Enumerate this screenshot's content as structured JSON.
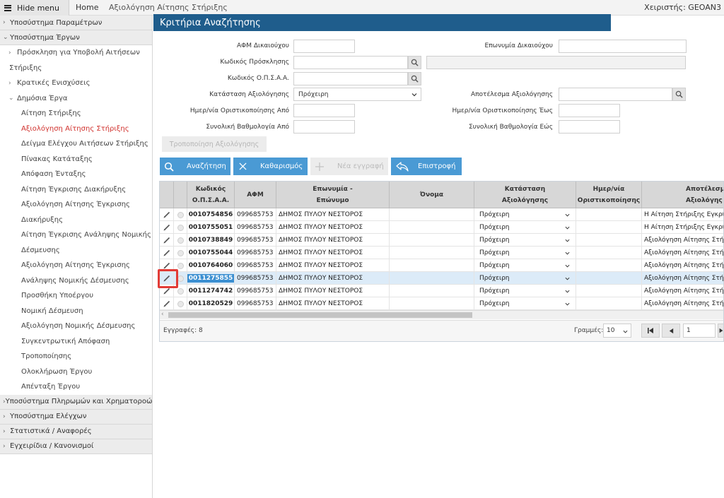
{
  "topbar": {
    "hide_menu": "Hide menu",
    "home": "Home",
    "breadcrumb": "Αξιολόγηση Αίτησης Στήριξης",
    "user": "Χειριστής: GEOAN3"
  },
  "sidebar": {
    "sec_params": "Υποσύστημα Παραμέτρων",
    "sec_projects": "Υποσύστημα Έργων",
    "sub_invitation_1": "Πρόσκληση για Υποβολή Αιτήσεων",
    "sub_invitation_2": "Στήριξης",
    "sub_state_aid": "Κρατικές Ενισχύσεις",
    "sub_public_works": "Δημόσια Έργα",
    "leaves": [
      "Αίτηση Στήριξης",
      "Αξιολόγηση Αίτησης Στήριξης",
      "Δείγμα Ελέγχου Αιτήσεων Στήριξης",
      "Πίνακας Κατάταξης",
      "Απόφαση Ένταξης",
      "Αίτηση Έγκρισης Διακήρυξης",
      "Αξιολόγηση Αίτησης Έγκρισης",
      "Διακήρυξης",
      "Αίτηση Έγκρισης Ανάληψης Νομικής",
      "Δέσμευσης",
      "Αξιολόγηση Αίτησης Έγκρισης",
      "Ανάληψης Νομικής Δέσμευσης",
      "Προσθήκη Υποέργου",
      "Νομική Δέσμευση",
      "Αξιολόγηση Νομικής Δέσμευσης",
      "Συγκεντρωτική Απόφαση",
      "Τροποποίησης",
      "Ολοκλήρωση Έργου",
      "Απένταξη Έργου"
    ],
    "sec_payments": "Υποσύστημα Πληρωμών και Χρηματοροών",
    "sec_checks": "Υποσύστημα Ελέγχων",
    "sec_stats": "Στατιστικά / Αναφορές",
    "sec_manuals": "Εγχειρίδια / Κανονισμοί"
  },
  "panel": {
    "title": "Κριτήρια Αναζήτησης"
  },
  "form": {
    "afm_label": "ΑΦΜ Δικαιούχου",
    "afm_value": "",
    "name_label": "Επωνυμία Δικαιούχου",
    "name_value": "",
    "invitation_label": "Κωδικός Πρόσκλησης",
    "invitation_value": "",
    "invitation_desc": "",
    "opsaa_label": "Κωδικός Ο.Π.Σ.Α.Α.",
    "opsaa_value": "",
    "status_label": "Κατάσταση Αξιολόγησης",
    "status_value": "Πρόχειρη",
    "result_label": "Αποτέλεσμα Αξιολόγησης",
    "result_value": "",
    "date_from_label": "Ημερ/νία Οριστικοποίησης Από",
    "date_from_value": "",
    "date_to_label": "Ημερ/νία Οριστικοποίησης Έως",
    "date_to_value": "",
    "score_from_label": "Συνολική Βαθμολογία Από",
    "score_from_value": "",
    "score_to_label": "Συνολική Βαθμολογία Εώς",
    "score_to_value": ""
  },
  "buttons": {
    "modify": "Τροποποίηση Αξιολόγησης",
    "search": "Αναζήτηση",
    "clear": "Καθαρισμός",
    "new": "Νέα εγγραφή",
    "back": "Επιστροφή"
  },
  "grid": {
    "headers": {
      "code_1": "Κωδικός",
      "code_2": "Ο.Π.Σ.Α.Α.",
      "afm": "ΑΦΜ",
      "surname_1": "Επωνυμία -",
      "surname_2": "Επώνυμο",
      "name": "Όνομα",
      "status_1": "Κατάσταση",
      "status_2": "Αξιολόγησης",
      "date_1": "Ημερ/νία",
      "date_2": "Οριστικοποίησης",
      "result_1": "Αποτέλεσμ",
      "result_2": "Αξιολόγης"
    },
    "rows": [
      {
        "code": "0010754856",
        "afm": "099685753",
        "surname": "ΔΗΜΟΣ ΠΥΛΟΥ ΝΕΣΤΟΡΟΣ",
        "name": "",
        "status": "Πρόχειρη",
        "date": "",
        "result": "Η Αίτηση Στήριξης Εγκρίθη"
      },
      {
        "code": "0010755051",
        "afm": "099685753",
        "surname": "ΔΗΜΟΣ ΠΥΛΟΥ ΝΕΣΤΟΡΟΣ",
        "name": "",
        "status": "Πρόχειρη",
        "date": "",
        "result": "Η Αίτηση Στήριξης Εγκρίθη"
      },
      {
        "code": "0010738849",
        "afm": "099685753",
        "surname": "ΔΗΜΟΣ ΠΥΛΟΥ ΝΕΣΤΟΡΟΣ",
        "name": "",
        "status": "Πρόχειρη",
        "date": "",
        "result": "Αξιολόγηση Αίτησης Στήρι"
      },
      {
        "code": "0010755044",
        "afm": "099685753",
        "surname": "ΔΗΜΟΣ ΠΥΛΟΥ ΝΕΣΤΟΡΟΣ",
        "name": "",
        "status": "Πρόχειρη",
        "date": "",
        "result": "Αξιολόγηση Αίτησης Στήρι"
      },
      {
        "code": "0010764060",
        "afm": "099685753",
        "surname": "ΔΗΜΟΣ ΠΥΛΟΥ ΝΕΣΤΟΡΟΣ",
        "name": "",
        "status": "Πρόχειρη",
        "date": "",
        "result": "Αξιολόγηση Αίτησης Στήρι"
      },
      {
        "code": "0011275855",
        "afm": "099685753",
        "surname": "ΔΗΜΟΣ ΠΥΛΟΥ ΝΕΣΤΟΡΟΣ",
        "name": "",
        "status": "Πρόχειρη",
        "date": "",
        "result": "Αξιολόγηση Αίτησης Στήρι"
      },
      {
        "code": "0011274742",
        "afm": "099685753",
        "surname": "ΔΗΜΟΣ ΠΥΛΟΥ ΝΕΣΤΟΡΟΣ",
        "name": "",
        "status": "Πρόχειρη",
        "date": "",
        "result": "Αξιολόγηση Αίτησης Στήρι"
      },
      {
        "code": "0011820529",
        "afm": "099685753",
        "surname": "ΔΗΜΟΣ ΠΥΛΟΥ ΝΕΣΤΟΡΟΣ",
        "name": "",
        "status": "Πρόχειρη",
        "date": "",
        "result": "Αξιολόγηση Αίτησης Στήρι"
      }
    ],
    "selected_index": 5
  },
  "footer": {
    "records": "Εγγραφές: 8",
    "rows_label": "Γραμμές:",
    "rows_value": "10",
    "page_value": "1"
  },
  "colors": {
    "panel_title_bg": "#1f5d8c",
    "button_blue": "#4a9ad4",
    "active_menu": "#d0312d",
    "highlight_red": "#e23b36"
  }
}
